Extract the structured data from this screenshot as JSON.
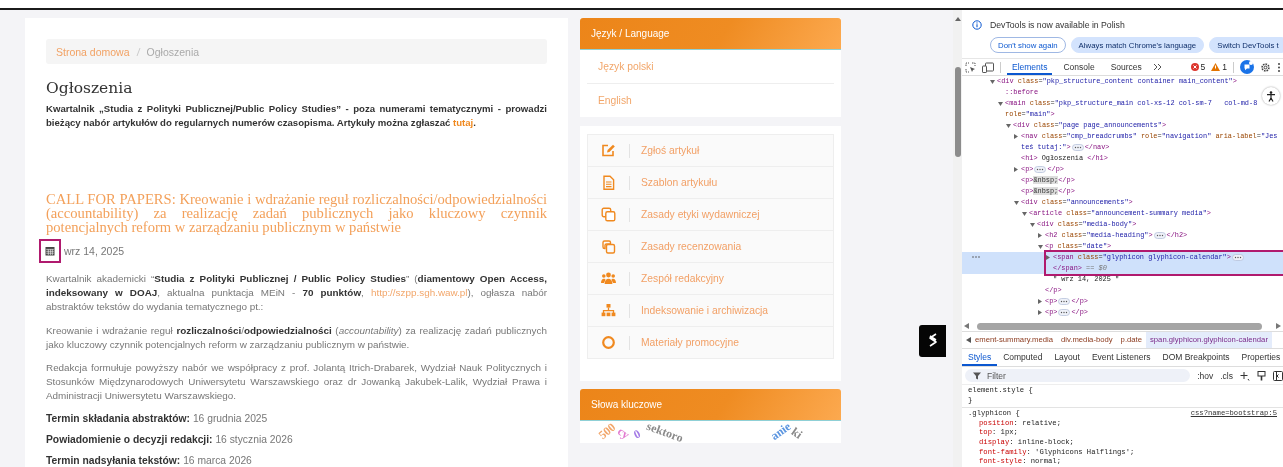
{
  "page": {
    "breadcrumbs": [
      {
        "label": "Strona domowa",
        "kind": "link"
      },
      {
        "label": "Ogłoszenia",
        "kind": "current"
      }
    ],
    "heading": "Ogłoszenia",
    "intro": [
      {
        "kind": "text",
        "text": "Kwartalnik „Studia z Polityki Publicznej/Public Policy Studies” - poza numerami tematycznymi - prowadzi bieżący nabór artykułów do regularnych numerów czasopisma. Artykuły można zgłaszać "
      },
      {
        "kind": "link",
        "text": "tutaj"
      },
      {
        "kind": "text",
        "text": "."
      }
    ],
    "announcement": {
      "title": "CALL FOR PAPERS: Kreowanie i wdrażanie reguł rozliczalności/odpowiedzialności (accountability) za realizację zadań publicznych jako kluczowy czynnik potencjalnych reform w zarządzaniu publicznym w państwie",
      "date": "wrz 14, 2025",
      "date_icon_annotated": true,
      "paragraphs": [
        [
          {
            "kind": "text",
            "text": "Kwartalnik akademicki “**Studia z Polityki Publicznej / Public Policy Studies**” (**diamentowy Open Access, indeksowany w DOAJ**, aktualna punktacja MEiN - **70 punktów**, "
          },
          {
            "kind": "link",
            "text": "http://szpp.sgh.waw.pl"
          },
          {
            "kind": "text",
            "text": "), ogłasza nabór abstraktów tekstów do wydania tematycznego pt.:"
          }
        ],
        [
          {
            "kind": "text",
            "text": "Kreowanie i wdrażanie reguł **rozliczalności**/**odpowiedzialności** (*accountability*) za realizację zadań publicznych jako kluczowy czynnik potencjalnych reform w zarządzaniu publicznym w państwie."
          }
        ],
        [
          {
            "kind": "text",
            "text": "Redakcja formułuje powyższy nabór we współpracy z prof. Jolantą Itrich-Drabarek, Wydział Nauk Politycznych i Stosunków Międzynarodowych Uniwersytetu Warszawskiego oraz dr Jowanką Jakubek-Lalik, Wydział Prawa i Administracji Uniwersytetu Warszawskiego."
          }
        ]
      ],
      "terms": [
        {
          "label": "Termin składania abstraktów:",
          "value": "16 grudnia 2025"
        },
        {
          "label": "Powiadomienie o decyzji redakcji:",
          "value": "16 stycznia 2026"
        },
        {
          "label": "Termin nadsyłania tekstów:",
          "value": "16 marca 2026"
        }
      ]
    }
  },
  "sidebar": {
    "language": {
      "title": "Język / Language",
      "items": [
        "Język polski",
        "English"
      ]
    },
    "menu": [
      {
        "label": "Zgłoś artykuł"
      },
      {
        "label": "Szablon artykułu"
      },
      {
        "label": "Zasady etyki wydawniczej"
      },
      {
        "label": "Zasady recenzowania"
      },
      {
        "label": "Zespół redakcyjny"
      },
      {
        "label": "Indeksowanie i archiwizacja"
      },
      {
        "label": "Materiały promocyjne"
      }
    ],
    "keywords": {
      "title": "Słowa kluczowe",
      "words": [
        {
          "text": "500",
          "color": "#f2a66a"
        },
        {
          "text": "cy",
          "color": "#e27bd0"
        },
        {
          "text": "0",
          "color": "#a47be6"
        },
        {
          "text": "sektoro",
          "color": "#8a8a8a"
        },
        {
          "text": "anie",
          "color": "#5b95e0"
        },
        {
          "text": "ki",
          "color": "#8a8a8a"
        }
      ]
    }
  },
  "devtools": {
    "notice": {
      "text": "DevTools is now available in Polish",
      "buttons": [
        {
          "label": "Don't show again",
          "kind": "outline"
        },
        {
          "label": "Always match Chrome's language",
          "kind": "filled"
        },
        {
          "label": "Switch DevTools t",
          "kind": "filled"
        }
      ]
    },
    "tabs": [
      {
        "label": "Elements",
        "selected": true
      },
      {
        "label": "Console",
        "selected": false
      },
      {
        "label": "Sources",
        "selected": false
      }
    ],
    "errors": "5",
    "warnings": "1",
    "dom": [
      {
        "expanded": true,
        "selected": false,
        "rows": [
          [
            {
              "kind": "markup",
              "text": "<div class=\"pkp_structure_content container main_content\">"
            }
          ]
        ],
        "children": [
          {
            "selected": false,
            "rows": [
              [
                {
                  "kind": "pseudo",
                  "text": "::before"
                }
              ]
            ]
          },
          {
            "expanded": true,
            "selected": false,
            "rows": [
              [
                {
                  "kind": "markup",
                  "text": "<main class=\"pkp_structure_main col-xs-12 col-sm-7   col-md-8"
                }
              ],
              [
                {
                  "kind": "markup",
                  "text": "role=\"main\">"
                }
              ]
            ],
            "children": [
              {
                "expanded": true,
                "selected": false,
                "rows": [
                  [
                    {
                      "kind": "markup",
                      "text": "<div class=\"page page_announcements\">"
                    }
                  ]
                ],
                "children": [
                  {
                    "expanded": false,
                    "selected": false,
                    "rows": [
                      [
                        {
                          "kind": "markup",
                          "text": "<nav class=\"cmp_breadcrumbs\" role=\"navigation\" aria-label=\"Jes"
                        }
                      ],
                      [
                        {
                          "kind": "value",
                          "text": "teś tutaj:\""
                        },
                        {
                          "kind": "markup",
                          "text": ">"
                        },
                        {
                          "kind": "ellipsis"
                        },
                        {
                          "kind": "markup",
                          "text": "</nav>"
                        }
                      ]
                    ]
                  },
                  {
                    "selected": false,
                    "rows": [
                      [
                        {
                          "kind": "markup",
                          "text": "<h1>"
                        },
                        {
                          "kind": "text",
                          "text": " Ogłoszenia "
                        },
                        {
                          "kind": "markup",
                          "text": "</h1>"
                        }
                      ]
                    ]
                  },
                  {
                    "expanded": false,
                    "selected": false,
                    "rows": [
                      [
                        {
                          "kind": "markup",
                          "text": "<p>"
                        },
                        {
                          "kind": "ellipsis"
                        },
                        {
                          "kind": "markup",
                          "text": "</p>"
                        }
                      ]
                    ]
                  },
                  {
                    "selected": false,
                    "rows": [
                      [
                        {
                          "kind": "markup",
                          "text": "<p>"
                        },
                        {
                          "kind": "entity",
                          "text": "&nbsp;"
                        },
                        {
                          "kind": "markup",
                          "text": "</p>"
                        }
                      ]
                    ]
                  },
                  {
                    "selected": false,
                    "rows": [
                      [
                        {
                          "kind": "markup",
                          "text": "<p>"
                        },
                        {
                          "kind": "entity",
                          "text": "&nbsp;"
                        },
                        {
                          "kind": "markup",
                          "text": "</p>"
                        }
                      ]
                    ]
                  },
                  {
                    "expanded": true,
                    "selected": false,
                    "rows": [
                      [
                        {
                          "kind": "markup",
                          "text": "<div class=\"announcements\">"
                        }
                      ]
                    ],
                    "children": [
                      {
                        "expanded": true,
                        "selected": false,
                        "rows": [
                          [
                            {
                              "kind": "markup",
                              "text": "<article class=\"announcement-summary media\">"
                            }
                          ]
                        ],
                        "children": [
                          {
                            "expanded": true,
                            "selected": false,
                            "rows": [
                              [
                                {
                                  "kind": "markup",
                                  "text": "<div class=\"media-body\">"
                                }
                              ]
                            ],
                            "children": [
                              {
                                "expanded": false,
                                "selected": false,
                                "rows": [
                                  [
                                    {
                                      "kind": "markup",
                                      "text": "<h2 class=\"media-heading\">"
                                    },
                                    {
                                      "kind": "ellipsis"
                                    },
                                    {
                                      "kind": "markup",
                                      "text": "</h2>"
                                    }
                                  ]
                                ]
                              },
                              {
                                "expanded": true,
                                "selected": false,
                                "rows": [
                                  [
                                    {
                                      "kind": "markup",
                                      "text": "<p class=\"date\">"
                                    }
                                  ]
                                ],
                                "close": "</p>",
                                "children": [
                                  {
                                    "expanded": false,
                                    "selected": true,
                                    "annotated": true,
                                    "rows": [
                                      [
                                        {
                                          "kind": "markup",
                                          "text": "<span class=\"glyphicon glyphicon-calendar\">"
                                        },
                                        {
                                          "kind": "ellipsis"
                                        }
                                      ],
                                      [
                                        {
                                          "kind": "markup",
                                          "text": "</span>"
                                        },
                                        {
                                          "kind": "hint",
                                          "text": " == $0"
                                        }
                                      ]
                                    ]
                                  },
                                  {
                                    "selected": false,
                                    "rows": [
                                      [
                                        {
                                          "kind": "text",
                                          "text": "\" wrz 14, 2025 \""
                                        }
                                      ]
                                    ]
                                  }
                                ]
                              },
                              {
                                "expanded": false,
                                "selected": false,
                                "rows": [
                                  [
                                    {
                                      "kind": "markup",
                                      "text": "<p>"
                                    },
                                    {
                                      "kind": "ellipsis"
                                    },
                                    {
                                      "kind": "markup",
                                      "text": "</p>"
                                    }
                                  ]
                                ]
                              },
                              {
                                "expanded": false,
                                "selected": false,
                                "rows": [
                                  [
                                    {
                                      "kind": "markup",
                                      "text": "<p>"
                                    },
                                    {
                                      "kind": "ellipsis"
                                    },
                                    {
                                      "kind": "markup",
                                      "text": "</p>"
                                    }
                                  ]
                                ]
                              }
                            ]
                          }
                        ]
                      }
                    ]
                  }
                ]
              }
            ]
          }
        ]
      }
    ],
    "path": [
      {
        "label": "ement-summary.media",
        "selected": false
      },
      {
        "label": "div.media-body",
        "selected": false
      },
      {
        "label": "p.date",
        "selected": false
      },
      {
        "label": "span.glyphicon.glyphicon-calendar",
        "selected": true
      }
    ],
    "pane_tabs": [
      {
        "label": "Styles",
        "selected": true
      },
      {
        "label": "Computed",
        "selected": false
      },
      {
        "label": "Layout",
        "selected": false
      },
      {
        "label": "Event Listeners",
        "selected": false
      },
      {
        "label": "DOM Breakpoints",
        "selected": false
      },
      {
        "label": "Properties",
        "selected": false
      }
    ],
    "filter": {
      "placeholder": "Filter"
    },
    "filter_buttons": [
      ":hov",
      ".cls"
    ],
    "rules": [
      {
        "selector": "element.style {",
        "end": "}"
      },
      {
        "selector": ".glyphicon {",
        "source": "css?name=bootstrap:5",
        "declarations": [
          "position: relative;",
          "top: 1px;",
          "display: inline-block;",
          "font-family: 'Glyphicons Halflings';",
          "font-style: normal;"
        ]
      }
    ]
  }
}
